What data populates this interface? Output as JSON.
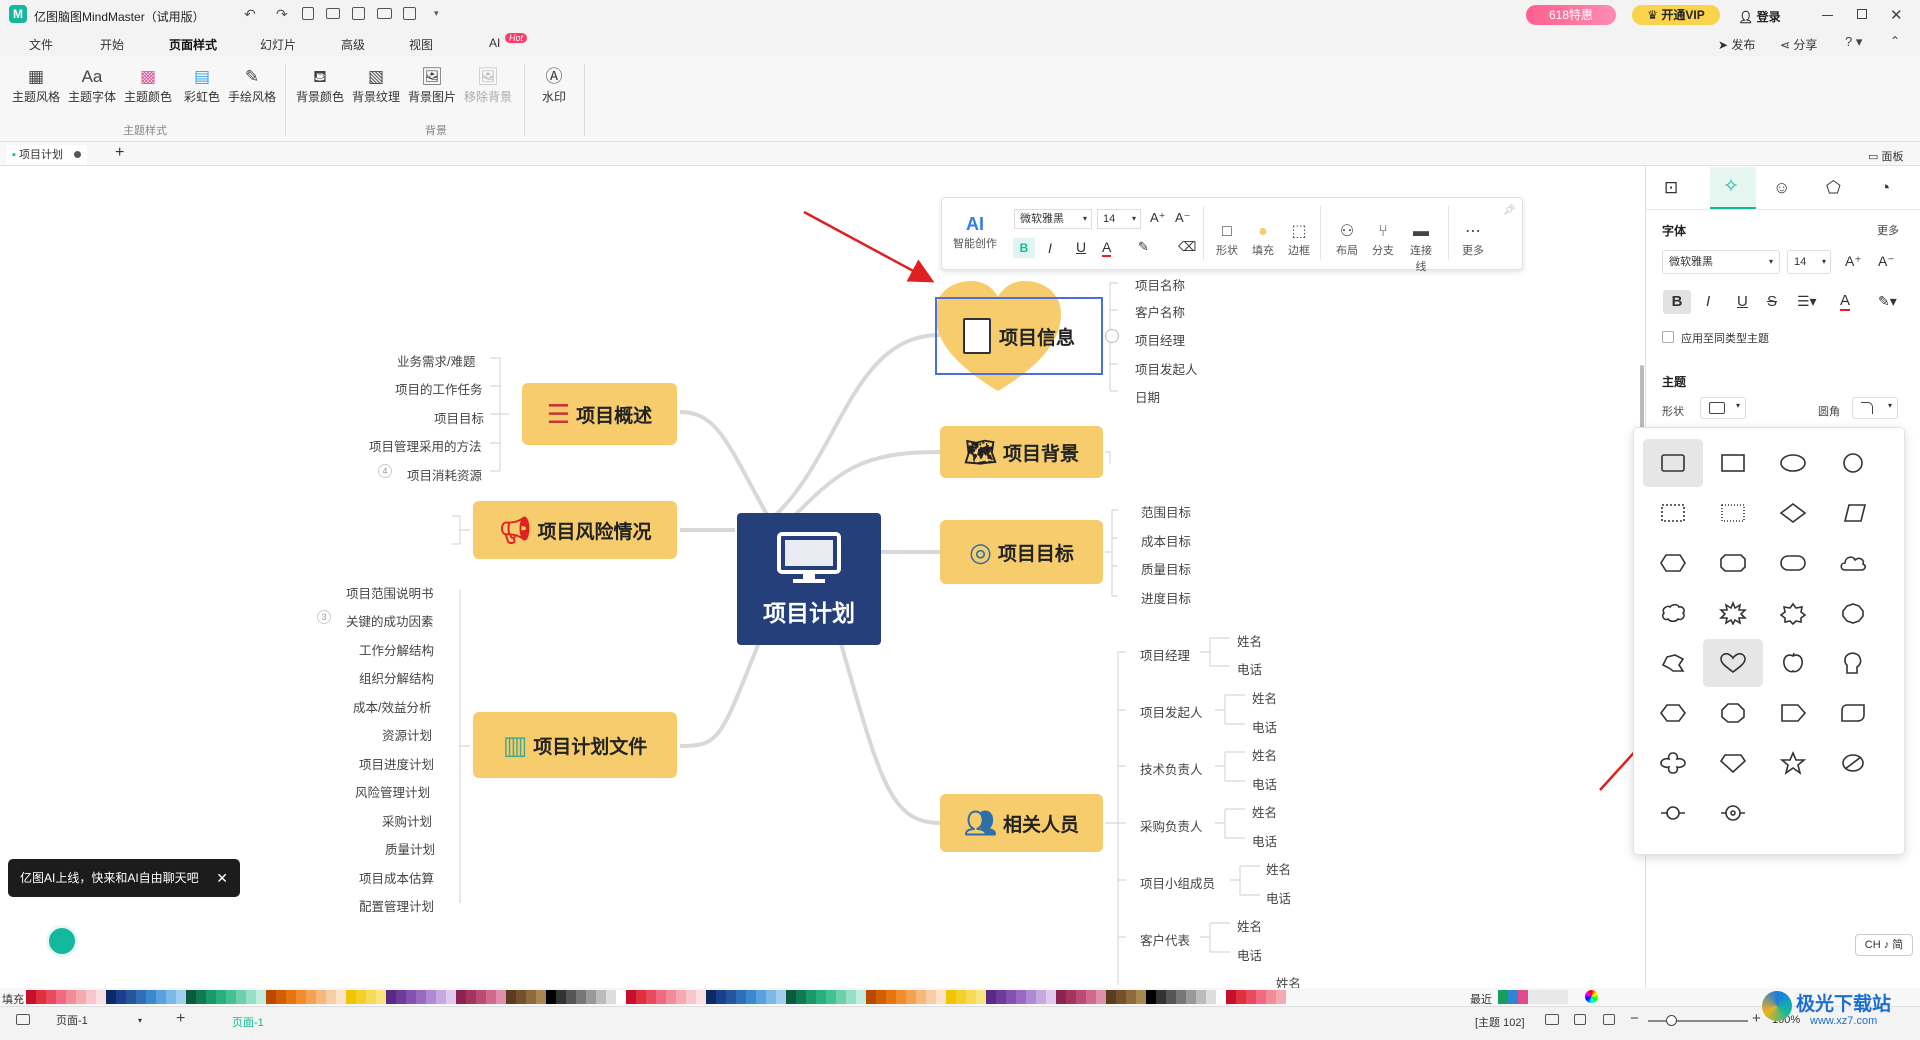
{
  "app": {
    "title": "亿图脑图MindMaster（试用版）",
    "promo": "618特惠",
    "vip": "开通VIP",
    "login": "登录",
    "publish": "发布",
    "share": "分享"
  },
  "menu": [
    "文件",
    "开始",
    "页面样式",
    "幻灯片",
    "高级",
    "视图",
    "AI"
  ],
  "menu_hot": "Hot",
  "ribbon": {
    "theme_items": [
      "主题风格",
      "主题字体",
      "主题颜色",
      "彩虹色",
      "手绘风格"
    ],
    "theme_group": "主题样式",
    "bg_items": [
      "背景颜色",
      "背景纹理",
      "背景图片",
      "移除背景"
    ],
    "bg_group": "背景",
    "watermark": "水印"
  },
  "doc_tab": "项目计划",
  "panel_toggle": "面板",
  "float_toolbar": {
    "ai": "智能创作",
    "font": "微软雅黑",
    "size": "14",
    "items": [
      "形状",
      "填充",
      "边框",
      "布局",
      "分支",
      "连接线",
      "更多"
    ]
  },
  "central": "项目计划",
  "topics": {
    "info": "项目信息",
    "background": "项目背景",
    "goal": "项目目标",
    "people": "相关人员",
    "overview": "项目概述",
    "risk": "项目风险情况",
    "docs": "项目计划文件"
  },
  "info_leaves": [
    "项目名称",
    "客户名称",
    "项目经理",
    "项目发起人",
    "日期"
  ],
  "goal_leaves": [
    "范围目标",
    "成本目标",
    "质量目标",
    "进度目标"
  ],
  "overview_leaves": [
    "业务需求/难题",
    "项目的工作任务",
    "项目目标",
    "项目管理采用的方法",
    "项目消耗资源"
  ],
  "overview_collapsed": "4",
  "docs_leaves": [
    "项目范围说明书",
    "关键的成功因素",
    "工作分解结构",
    "组织分解结构",
    "成本/效益分析",
    "资源计划",
    "项目进度计划",
    "风险管理计划",
    "采购计划",
    "质量计划",
    "项目成本估算",
    "配置管理计划"
  ],
  "docs_collapsed": "3",
  "people": [
    "项目经理",
    "项目发起人",
    "技术负责人",
    "采购负责人",
    "项目小组成员",
    "客户代表"
  ],
  "people_sub": [
    "姓名",
    "电话"
  ],
  "ai_tip": "亿图AI上线，快来和AI自由聊天吧",
  "right_panel": {
    "font_header": "字体",
    "more": "更多",
    "font": "微软雅黑",
    "size": "14",
    "apply_same": "应用至同类型主题",
    "theme_header": "主题",
    "shape_label": "形状",
    "corner_label": "圆角"
  },
  "status": {
    "fill": "填充",
    "recent": "最近",
    "page": "页面-1",
    "page_tab": "页面-1",
    "topic_count": "[主题 102]",
    "zoom": "100%",
    "lang": "CH ♪ 简"
  },
  "watermark_site": "极光下载站",
  "watermark_url": "www.xz7.com",
  "colors": {
    "accent": "#14b89c",
    "topic": "#f6cc6c",
    "central": "#243f7a",
    "select": "#4a6fd9",
    "arrow": "#e02020"
  }
}
